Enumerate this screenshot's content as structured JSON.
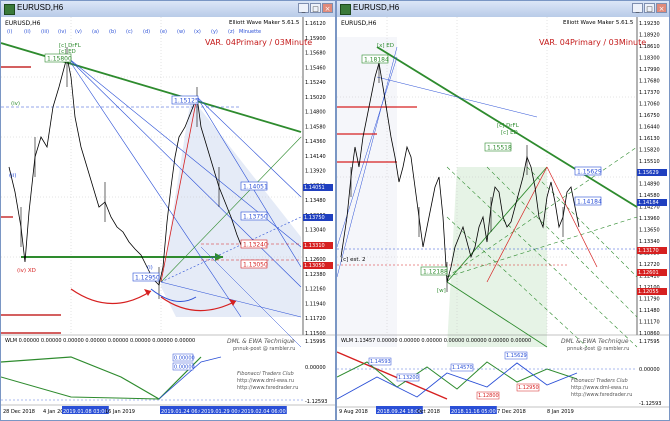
{
  "left_window": {
    "title": "EURUSD,H6",
    "symbol_label": "EURUSD,H6",
    "indicator_name": "Elliott Wave Maker 5.61.5",
    "variant_label": "VAR. 04Primary / 03Minute",
    "top_scale": [
      "(i)",
      "(ii)",
      "(iii)",
      "(iv)",
      "(v)",
      "(a)",
      "(b)",
      "(c)",
      "(d)",
      "(e)",
      "(w)",
      "(x)",
      "(y)",
      "(z)",
      "Minuette"
    ],
    "wave_labels": {
      "c_drl": "[c] DrFL",
      "c_ed": "[c] ED",
      "iv": "(iv)",
      "a_xd": "(iv) XD",
      "ii": "(ii)",
      "i": "(i)"
    },
    "level_boxes": {
      "peak": "1.15800",
      "mid_peak": "1.15125",
      "low": "1.12950",
      "r1": "1.14051",
      "r2": "1.13750",
      "r3": "1.13240",
      "r4": "1.13050"
    },
    "price_axis": [
      "1.16120",
      "1.15900",
      "1.15680",
      "1.15460",
      "1.15240",
      "1.15020",
      "1.14800",
      "1.14580",
      "1.14360",
      "1.14140",
      "1.13920",
      "1.13700",
      "1.13480",
      "1.13260",
      "1.13040",
      "1.12820",
      "1.12600",
      "1.12380",
      "1.12160",
      "1.11940",
      "1.11720",
      "1.11500"
    ],
    "price_tags": [
      {
        "text": "1.14051",
        "color": "#1f3fbf"
      },
      {
        "text": "1.13750",
        "color": "#1f3fbf"
      },
      {
        "text": "1.13310",
        "color": "#d62020"
      },
      {
        "text": "1.13050",
        "color": "#d62020"
      }
    ],
    "sub_indicator": {
      "label": "WLM 0.00000 0.00000 0.00000 0.00000 0.00000 0.00000 0.00000 0.00000",
      "axis": [
        "1.15995",
        "0.00000",
        "-1.12593"
      ],
      "boxes": [
        "0.00000",
        "0.00000"
      ],
      "footer": [
        "Fibonacci Traders Club",
        "http://www.dml-ewa.ru",
        "http://www.fxredrader.ru"
      ],
      "brand": [
        "DML & EWA Technique",
        "pnnuk-post @ rambler.ru"
      ]
    },
    "time_axis": [
      "28 Dec 2018",
      "4 Jan 2019",
      "2019.01.08 03:00",
      "16 Jan 2019",
      "2019.01.24 06:00",
      "2019.01.29 00:00",
      "2019.02.04 06:00"
    ]
  },
  "right_window": {
    "title": "EURUSD,H6",
    "symbol_label": "EURUSD,H6",
    "indicator_name": "Elliott Wave Maker 5.61.5",
    "variant_label": "VAR. 04Primary / 03Minute",
    "wave_labels": {
      "c_drl": "[c] DrFL",
      "c_ed": "[c] ED",
      "x": "[x] ED",
      "w": "[w]",
      "est": "[c] est. 2"
    },
    "level_boxes": {
      "peak": "1.18184",
      "mid_peak": "1.15518",
      "low": "1.12188",
      "r1": "1.15629",
      "r2": "1.14184"
    },
    "price_axis": [
      "1.19230",
      "1.18920",
      "1.18610",
      "1.18300",
      "1.17990",
      "1.17680",
      "1.17370",
      "1.17060",
      "1.16750",
      "1.16440",
      "1.16130",
      "1.15820",
      "1.15510",
      "1.15200",
      "1.14890",
      "1.14580",
      "1.14270",
      "1.13960",
      "1.13650",
      "1.13340",
      "1.13030",
      "1.12720",
      "1.12410",
      "1.12100",
      "1.11790",
      "1.11480",
      "1.11170",
      "1.10860"
    ],
    "price_tags": [
      {
        "text": "1.15629",
        "color": "#1f3fbf"
      },
      {
        "text": "1.14184",
        "color": "#1f3fbf"
      },
      {
        "text": "1.13170",
        "color": "#d62020"
      },
      {
        "text": "1.12601",
        "color": "#d62020"
      },
      {
        "text": "1.12055",
        "color": "#d62020"
      }
    ],
    "sub_indicator": {
      "label": "WLM 1.13457 0.00000 0.00000 0.00000 0.00000 0.00000 0.00000 0.00000",
      "axis": [
        "1.17595",
        "0.00000",
        "-1.12593"
      ],
      "boxes": [
        "1.15629",
        "1.14593",
        "1.14570",
        "1.13200",
        "1.12950",
        "1.12800"
      ],
      "footer": [
        "Fibonacci Traders Club",
        "http://www.dml-ewa.ru",
        "http://www.fxredrader.ru"
      ],
      "brand": [
        "DML & EWA Technique",
        "pnnuk-post @ rambler.ru"
      ]
    },
    "time_axis": [
      "9 Aug 2018",
      "2018.09.24 18:00",
      "Oct 2018",
      "2018.11.16 05:00",
      "7 Dec 2018",
      "8 Jan 2019"
    ]
  },
  "colors": {
    "green": "#2e8b2e",
    "red": "#d62020",
    "blue": "#2a4fd6",
    "navy": "#2b3a8c",
    "shade": "#dfe6f5"
  }
}
